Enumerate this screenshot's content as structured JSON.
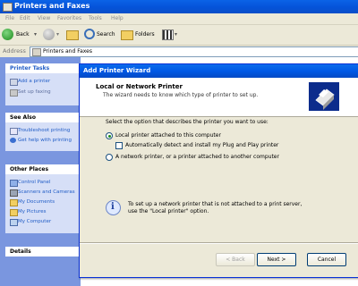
{
  "window": {
    "title": "Printers and Faxes"
  },
  "menu": [
    "File",
    "Edit",
    "View",
    "Favorites",
    "Tools",
    "Help"
  ],
  "toolbar": {
    "back": "Back",
    "search": "Search",
    "folders": "Folders"
  },
  "address": {
    "label": "Address",
    "value": "Printers and Faxes"
  },
  "taskpane": {
    "printer_tasks": {
      "title": "Printer Tasks",
      "items": [
        "Add a printer",
        "Set up faxing"
      ]
    },
    "see_also": {
      "title": "See Also",
      "items": [
        "Troubleshoot printing",
        "Get help with printing"
      ]
    },
    "other_places": {
      "title": "Other Places",
      "items": [
        "Control Panel",
        "Scanners and Cameras",
        "My Documents",
        "My Pictures",
        "My Computer"
      ]
    },
    "details": {
      "title": "Details"
    }
  },
  "wizard": {
    "title": "Add Printer Wizard",
    "heading": "Local or Network Printer",
    "subheading": "The wizard needs to know which type of printer to set up.",
    "prompt": "Select the option that describes the printer you want to use:",
    "option_local": "Local printer attached to this computer",
    "option_autodetect": "Automatically detect and install my Plug and Play printer",
    "option_network": "A network printer, or a printer attached to another computer",
    "info_line1": "To set up a network printer that is not attached to a print server,",
    "info_line2": "use the \"Local printer\" option.",
    "buttons": {
      "back": "< Back",
      "next": "Next >",
      "cancel": "Cancel"
    },
    "selected_option": "local"
  }
}
